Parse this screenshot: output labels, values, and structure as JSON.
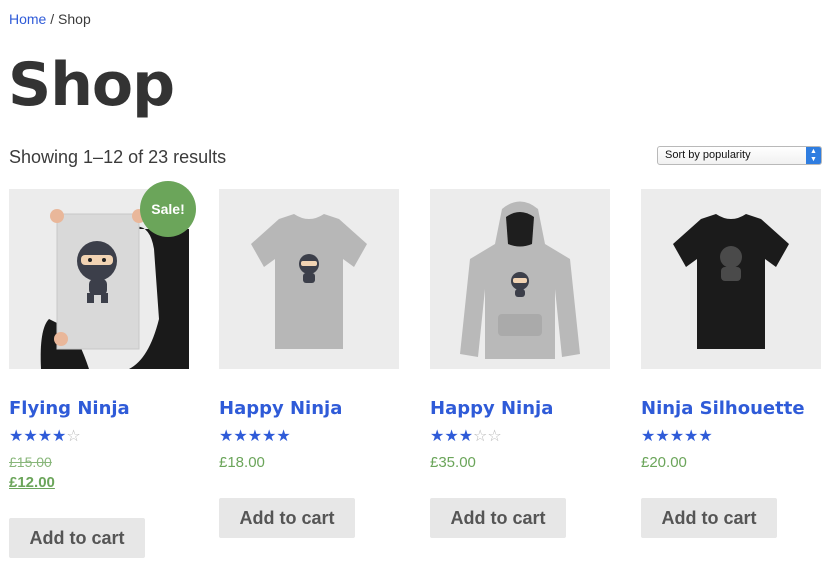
{
  "breadcrumb": {
    "home": "Home",
    "separator": " / ",
    "current": "Shop"
  },
  "page": {
    "title": "Shop",
    "result_count": "Showing 1–12 of 23 results"
  },
  "orderby": {
    "selected": "Sort by popularity"
  },
  "colors": {
    "link": "#2f5bd8",
    "sale": "#6ba55a",
    "button_bg": "#e7e7e7"
  },
  "products": [
    {
      "name": "Flying Ninja",
      "rating": 4,
      "price_old": "£15.00",
      "price": "£12.00",
      "on_sale": true,
      "sale_label": "Sale!",
      "cta": "Add to cart",
      "image": "poster-ninja"
    },
    {
      "name": "Happy Ninja",
      "rating": 5,
      "price": "£18.00",
      "on_sale": false,
      "cta": "Add to cart",
      "image": "grey-tshirt"
    },
    {
      "name": "Happy Ninja",
      "rating": 3,
      "price": "£35.00",
      "on_sale": false,
      "cta": "Add to cart",
      "image": "grey-hoodie"
    },
    {
      "name": "Ninja Silhouette",
      "rating": 5,
      "price": "£20.00",
      "on_sale": false,
      "cta": "Add to cart",
      "image": "black-tshirt"
    }
  ]
}
